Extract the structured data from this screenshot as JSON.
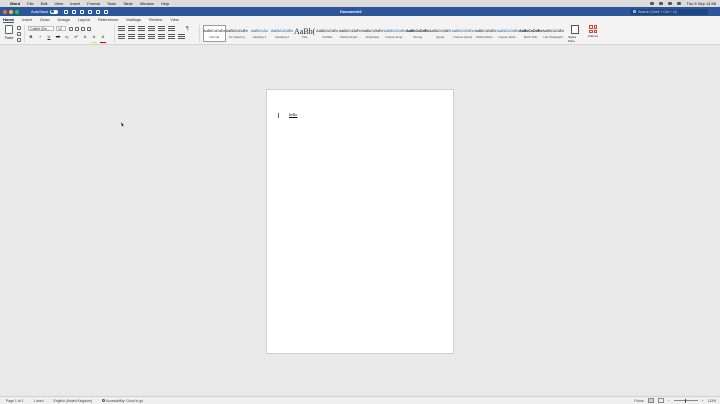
{
  "menubar": {
    "app": "Word",
    "items": [
      "File",
      "Edit",
      "View",
      "Insert",
      "Format",
      "Tools",
      "Table",
      "Window",
      "Help"
    ],
    "clock": "Thu 5 Sep 14:58"
  },
  "titlebar": {
    "autosave_label": "AutoSave",
    "doc_title": "Document2",
    "search_placeholder": "Search (Cmd + Ctrl + U)"
  },
  "tabs": [
    "Home",
    "Insert",
    "Draw",
    "Design",
    "Layout",
    "References",
    "Mailings",
    "Review",
    "View"
  ],
  "active_tab": "Home",
  "ribbon": {
    "paste_label": "Paste",
    "font_name": "Calibri (Bo...",
    "font_size": "12",
    "format_buttons": [
      "B",
      "I",
      "U",
      "ab",
      "x₂",
      "x²",
      "A",
      "A",
      "A"
    ],
    "pilcrow": "¶",
    "styles": [
      {
        "sample": "AaBbCcDdEe",
        "name": "Normal",
        "selected": true,
        "variant": ""
      },
      {
        "sample": "AaBbCcDdEe",
        "name": "No Spacing",
        "selected": false,
        "variant": ""
      },
      {
        "sample": "AaBbCcDc",
        "name": "Heading 1",
        "selected": false,
        "variant": "blue"
      },
      {
        "sample": "AaBbCcDdEe",
        "name": "Heading 2",
        "selected": false,
        "variant": "blue"
      },
      {
        "sample": "AaBb(",
        "name": "Title",
        "selected": false,
        "variant": "big"
      },
      {
        "sample": "AaBbCcDdEe",
        "name": "Subtitle",
        "selected": false,
        "variant": ""
      },
      {
        "sample": "AaBbCcDdEe",
        "name": "Subtle Emph...",
        "selected": false,
        "variant": "ital"
      },
      {
        "sample": "AaBbCcDdEe",
        "name": "Emphasis",
        "selected": false,
        "variant": "ital"
      },
      {
        "sample": "AaBbCcDdEe",
        "name": "Intense Emp...",
        "selected": false,
        "variant": "blue"
      },
      {
        "sample": "AaBbCcDdEe",
        "name": "Strong",
        "selected": false,
        "variant": "bold"
      },
      {
        "sample": "AaBbCcDdEe",
        "name": "Quote",
        "selected": false,
        "variant": "ital"
      },
      {
        "sample": "AaBbCcDdEe",
        "name": "Intense Quote",
        "selected": false,
        "variant": "blue"
      },
      {
        "sample": "AaBbCcDdEe",
        "name": "Subtle Refer...",
        "selected": false,
        "variant": ""
      },
      {
        "sample": "AaBbCcDdEe",
        "name": "Intense Refe...",
        "selected": false,
        "variant": "blue"
      },
      {
        "sample": "AaBbCcDdEe",
        "name": "Book Title",
        "selected": false,
        "variant": "bold"
      },
      {
        "sample": "AaBbCcDdEe",
        "name": "List Paragraph",
        "selected": false,
        "variant": ""
      }
    ],
    "styles_pane_label": "Styles Pane",
    "addins_label": "Add-ins"
  },
  "document": {
    "text": "hello"
  },
  "statusbar": {
    "page": "Page 1 of 1",
    "words": "1 word",
    "language": "English (United Kingdom)",
    "accessibility": "Accessibility: Good to go",
    "focus": "Focus",
    "zoom": "113%"
  },
  "colors": {
    "titlebar": "#2b579a",
    "canvas": "#e9e9e9",
    "page": "#ffffff"
  }
}
